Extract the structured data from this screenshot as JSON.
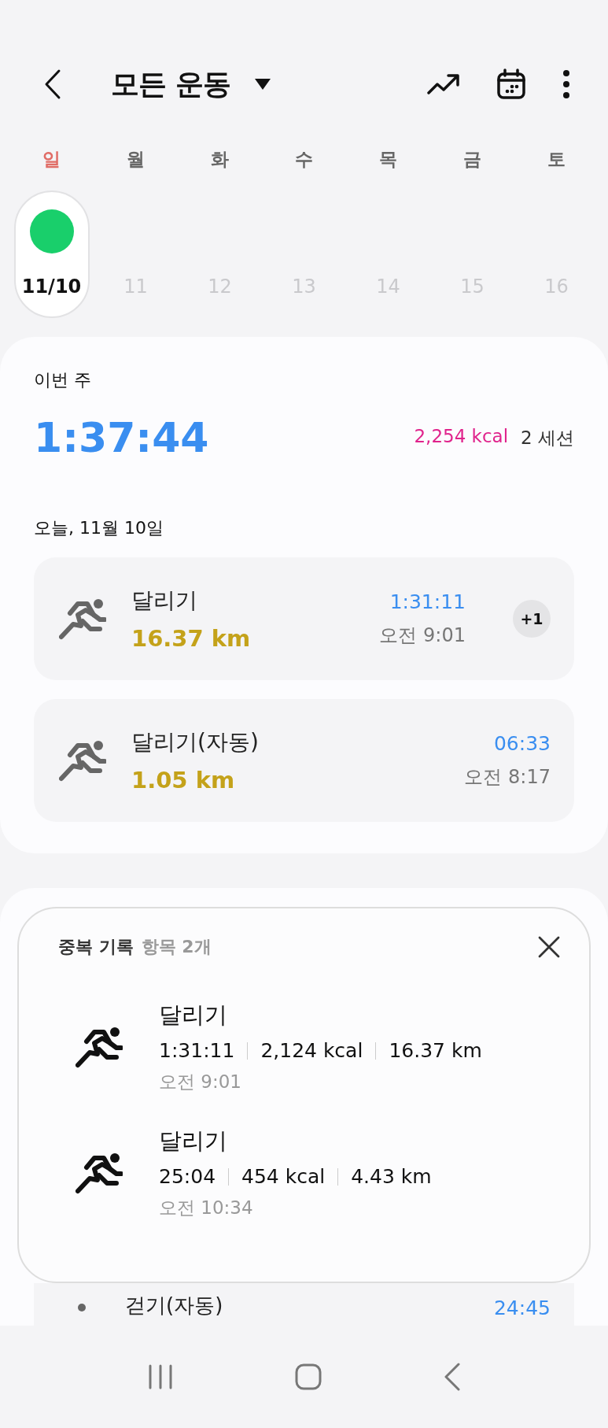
{
  "header": {
    "title": "모든 운동"
  },
  "week": {
    "days": [
      {
        "label": "일",
        "kind": "sunday"
      },
      {
        "label": "월",
        "kind": "weekday"
      },
      {
        "label": "화",
        "kind": "weekday"
      },
      {
        "label": "수",
        "kind": "weekday"
      },
      {
        "label": "목",
        "kind": "weekday"
      },
      {
        "label": "금",
        "kind": "weekday"
      },
      {
        "label": "토",
        "kind": "weekday"
      }
    ],
    "dates": [
      {
        "label": "11/10",
        "selected": true,
        "has_workout": true,
        "disabled": false
      },
      {
        "label": "11",
        "selected": false,
        "has_workout": false,
        "disabled": true
      },
      {
        "label": "12",
        "selected": false,
        "has_workout": false,
        "disabled": true
      },
      {
        "label": "13",
        "selected": false,
        "has_workout": false,
        "disabled": true
      },
      {
        "label": "14",
        "selected": false,
        "has_workout": false,
        "disabled": true
      },
      {
        "label": "15",
        "selected": false,
        "has_workout": false,
        "disabled": true
      },
      {
        "label": "16",
        "selected": false,
        "has_workout": false,
        "disabled": true
      }
    ]
  },
  "summary": {
    "label": "이번 주",
    "total_time": "1:37:44",
    "calories": "2,254 kcal",
    "sessions": "2 세션"
  },
  "today": {
    "heading": "오늘, 11월 10일",
    "entries": [
      {
        "name": "달리기",
        "distance": "16.37 km",
        "duration": "1:31:11",
        "start": "오전 9:01",
        "badge": "+1"
      },
      {
        "name": "달리기(자동)",
        "distance": "1.05 km",
        "duration": "06:33",
        "start": "오전 8:17"
      }
    ]
  },
  "popup": {
    "title": "중복 기록",
    "count": "항목 2개",
    "records": [
      {
        "name": "달리기",
        "duration": "1:31:11",
        "calories": "2,124 kcal",
        "distance": "16.37 km",
        "start": "오전 9:01"
      },
      {
        "name": "달리기",
        "duration": "25:04",
        "calories": "454 kcal",
        "distance": "4.43 km",
        "start": "오전 10:34"
      }
    ]
  },
  "peek": {
    "name": "걷기(자동)",
    "duration": "24:45"
  }
}
